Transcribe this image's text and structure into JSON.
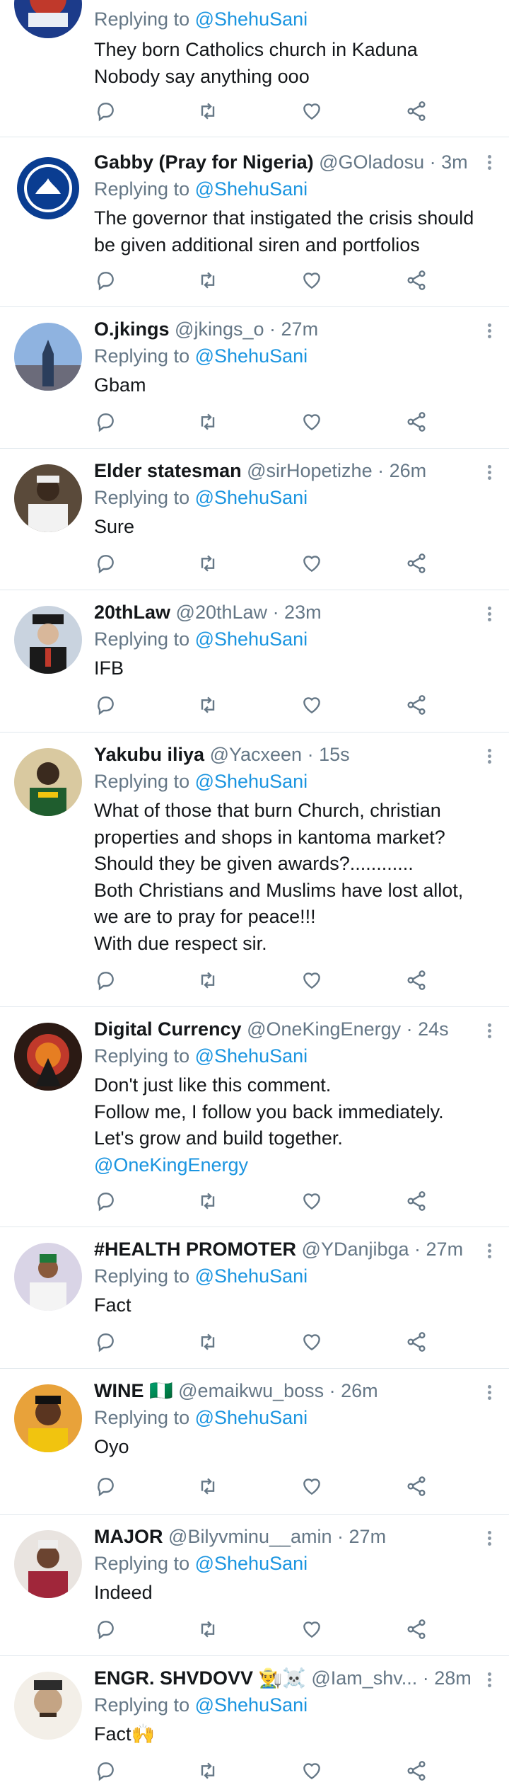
{
  "tweets": [
    {
      "name": "",
      "handle": "",
      "time": "",
      "replying_prefix": "Replying to",
      "replying_to": "@ShehuSani",
      "text_lines": [
        "They born Catholics church  in Kaduna",
        "Nobody say anything ooo"
      ]
    },
    {
      "name": "Gabby (Pray for Nigeria)",
      "handle": "@GOladosu",
      "time": "· 3m",
      "replying_prefix": "Replying to",
      "replying_to": "@ShehuSani",
      "text_lines": [
        "The governor that instigated the crisis should",
        "be given additional siren and portfolios"
      ]
    },
    {
      "name": "O.jkings",
      "handle": "@jkings_o",
      "time": "· 27m",
      "replying_prefix": "Replying to",
      "replying_to": "@ShehuSani",
      "text_lines": [
        "Gbam"
      ]
    },
    {
      "name": "Elder statesman",
      "handle": "@sirHopetizhe",
      "time": "· 26m",
      "replying_prefix": "Replying to",
      "replying_to": "@ShehuSani",
      "text_lines": [
        "Sure"
      ]
    },
    {
      "name": "20thLaw",
      "handle": "@20thLaw",
      "time": "· 23m",
      "replying_prefix": "Replying to",
      "replying_to": "@ShehuSani",
      "text_lines": [
        "IFB"
      ]
    },
    {
      "name": "Yakubu iliya",
      "handle": "@Yacxeen",
      "time": "· 15s",
      "replying_prefix": "Replying to",
      "replying_to": "@ShehuSani",
      "text_lines": [
        "What of those that burn Church, christian",
        "properties and shops in kantoma market?",
        "Should they be given awards?............",
        "Both Christians and Muslims have lost allot,",
        "we are to pray for peace!!!",
        "With due respect sir."
      ]
    },
    {
      "name": "Digital Currency",
      "handle": "@OneKingEnergy",
      "time": "· 24s",
      "replying_prefix": "Replying to",
      "replying_to": "@ShehuSani",
      "text_lines": [
        "Don't just like this comment.",
        "Follow me, I follow you back immediately.",
        "Let's grow and build together."
      ],
      "text_mention": "@OneKingEnergy"
    },
    {
      "name": "#HEALTH PROMOTER",
      "handle": "@YDanjibga",
      "time": "· 27m",
      "replying_prefix": "Replying to",
      "replying_to": "@ShehuSani",
      "text_lines": [
        "Fact"
      ]
    },
    {
      "name": "WINE 🇳🇬",
      "handle": "@emaikwu_boss",
      "time": "· 26m",
      "replying_prefix": "Replying to",
      "replying_to": "@ShehuSani",
      "text_lines": [
        "Oyo"
      ]
    },
    {
      "name": "MAJOR",
      "handle": "@Bilyvminu__amin",
      "time": "· 27m",
      "replying_prefix": "Replying to",
      "replying_to": "@ShehuSani",
      "text_lines": [
        "Indeed"
      ]
    },
    {
      "name": "ENGR. SHVDOVV 👨‍🌾☠️",
      "handle": "@Iam_shv...",
      "time": "· 28m",
      "replying_prefix": "Replying to",
      "replying_to": "@ShehuSani",
      "text_lines": [
        "Fact🙌"
      ]
    }
  ],
  "icons": [
    "reply-icon",
    "retweet-icon",
    "like-icon",
    "share-icon",
    "more-options-icon"
  ],
  "colors": {
    "mention": "#1b95e0",
    "muted": "#657786",
    "divider": "#e1e8ed"
  }
}
